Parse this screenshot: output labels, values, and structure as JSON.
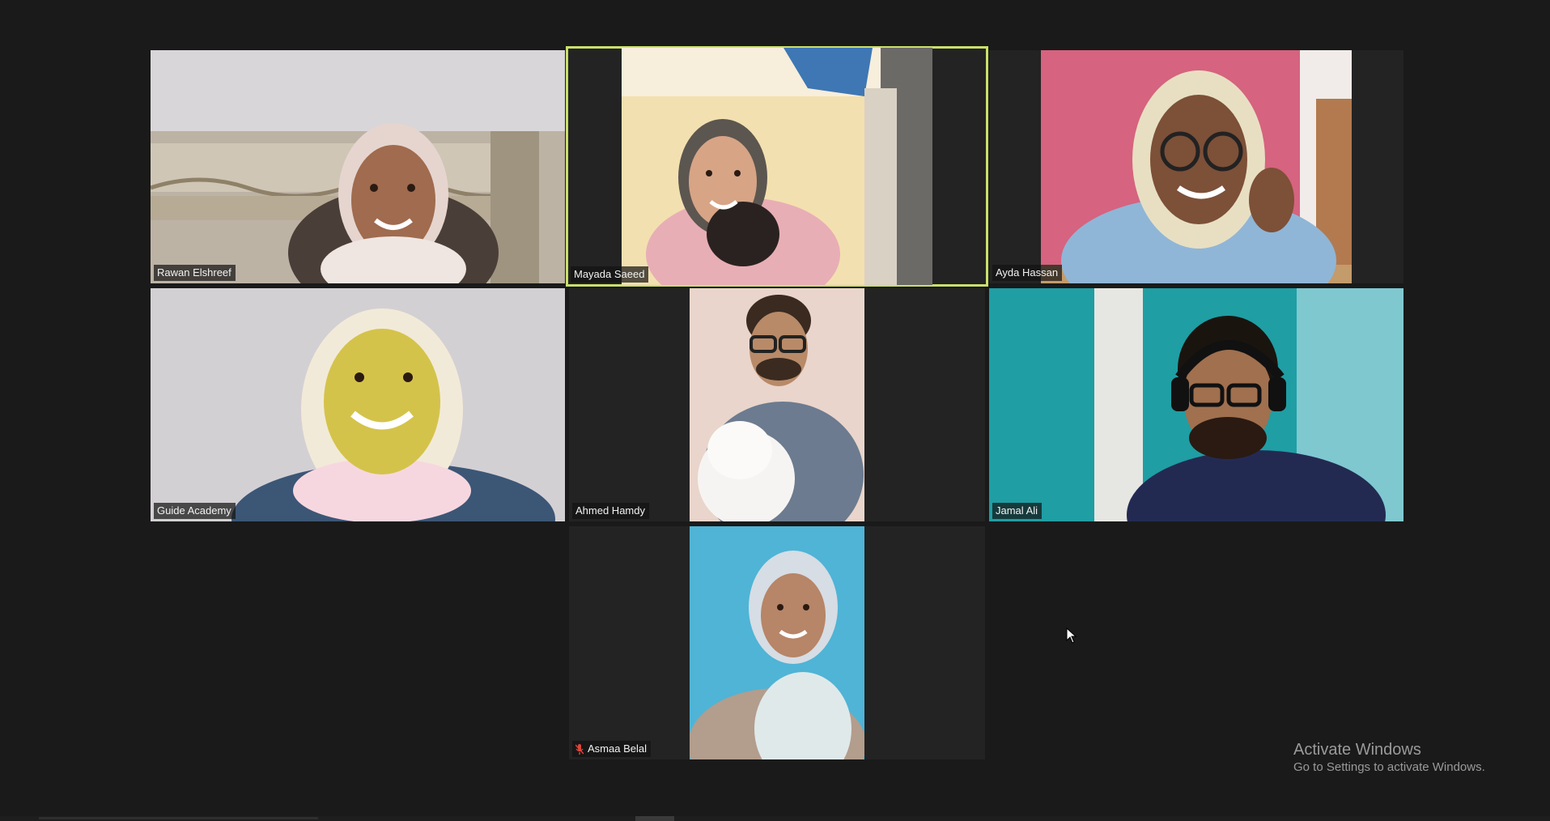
{
  "meeting": {
    "participants": [
      {
        "id": "rawan",
        "name": "Rawan Elshreef",
        "muted": false,
        "active_speaker": false
      },
      {
        "id": "mayada",
        "name": "Mayada Saeed",
        "muted": false,
        "active_speaker": true
      },
      {
        "id": "ayda",
        "name": "Ayda Hassan",
        "muted": false,
        "active_speaker": false
      },
      {
        "id": "guide",
        "name": "Guide Academy",
        "muted": false,
        "active_speaker": false
      },
      {
        "id": "ahmed",
        "name": "Ahmed Hamdy",
        "muted": false,
        "active_speaker": false
      },
      {
        "id": "jamal",
        "name": "Jamal Ali",
        "muted": false,
        "active_speaker": false
      },
      {
        "id": "asmaa",
        "name": "Asmaa Belal",
        "muted": true,
        "active_speaker": false
      }
    ],
    "active_speaker_color": "#c9e06b",
    "muted_icon_color": "#e0453a"
  },
  "watermark": {
    "title": "Activate Windows",
    "subtitle": "Go to Settings to activate Windows."
  }
}
